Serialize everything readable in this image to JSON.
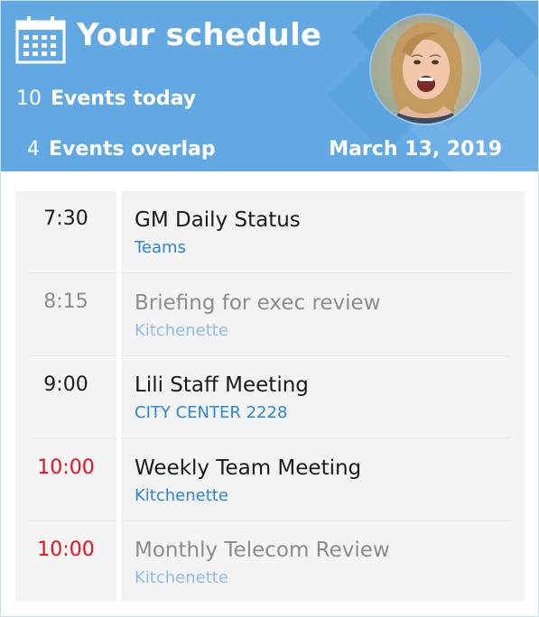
{
  "header": {
    "title": "Your schedule",
    "events_today_count": "10",
    "events_today_label": "Events today",
    "events_overlap_count": "4",
    "events_overlap_label": "Events overlap",
    "date": "March 13, 2019",
    "icon": "calendar-icon",
    "avatar": "profile-photo"
  },
  "colors": {
    "header_bg": "#62a8e2",
    "text_dark": "#1a1a1a",
    "text_muted": "#8c8c8c",
    "time_overlap": "#e81123",
    "link": "#2b86d9",
    "link_muted": "#8fbce6",
    "panel_bg": "#f4f4f4"
  },
  "events": [
    {
      "time": "7:30",
      "title": "GM Daily Status",
      "location": "Teams",
      "state": "active"
    },
    {
      "time": "8:15",
      "title": "Briefing for exec review",
      "location": "Kitchenette",
      "state": "past"
    },
    {
      "time": "9:00",
      "title": "Lili Staff Meeting",
      "location": "CITY CENTER 2228",
      "state": "active"
    },
    {
      "time": "10:00",
      "title": "Weekly Team Meeting",
      "location": "Kitchenette",
      "state": "overlap"
    },
    {
      "time": "10:00",
      "title": "Monthly Telecom Review",
      "location": "Kitchenette",
      "state": "overlap-past"
    }
  ]
}
